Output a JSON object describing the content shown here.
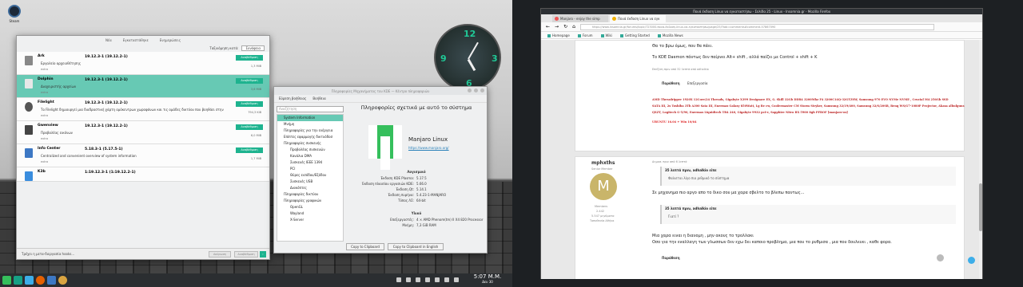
{
  "desktop": {
    "steam_label": "Steam",
    "clock_numbers": [
      "12",
      "3",
      "6",
      "9"
    ]
  },
  "discover": {
    "tabs": [
      "Νέα",
      "Εγκαταστάθηκε",
      "Ενημερώσεις"
    ],
    "sort_label": "Ταξινόμηση κατά:",
    "sort_value": "Συνάφεια",
    "items": [
      {
        "name": "Ark",
        "version": "19.12.3-1 (19.12.2-1)",
        "desc": "Εργαλείο αρχειοθέτησης",
        "source": "extra",
        "button": "Αναβάθμιση",
        "size": "1,3 MiB"
      },
      {
        "name": "Dolphin",
        "version": "19.12.3-1 (19.12.2-1)",
        "desc": "Διαχειριστής αρχείων",
        "source": "extra",
        "button": "Αναβάθμιση",
        "size": "3,6 MiB"
      },
      {
        "name": "Filelight",
        "version": "19.12.3-1 (19.12.2-1)",
        "desc": "Το Filelight δημιουργεί μια διαδραστική χάρτη ομόκεντρων χωροφάνων και τις ομάδες δικτύου που βοηθάει στην απ",
        "source": "extra",
        "button": "Αναβάθμιση",
        "size": "794,3 KiB"
      },
      {
        "name": "Gwenview",
        "version": "19.12.3-1 (19.12.2-1)",
        "desc": "Προβολέας εικόνων",
        "source": "extra",
        "button": "Αναβάθμιση",
        "size": "6,0 MiB"
      },
      {
        "name": "Info Center",
        "version": "5.18.3-1 (5.17.5-1)",
        "desc": "Centralized and convenient overview of system information",
        "source": "extra",
        "button": "Αναβάθμιση",
        "size": "1,7 MiB"
      },
      {
        "name": "K3b",
        "version": "1:19.12.3-1 (1:19.12.2-1)",
        "desc": "",
        "source": "",
        "button": "",
        "size": ""
      }
    ],
    "footer_status": "Τρέχει η μετα-διεργασία hooks...",
    "footer_btn1": "Ακύρωση",
    "footer_btn2": "Αναβάθμιση"
  },
  "info": {
    "title": "Πληροφορίες Μηχανήματος του KDE — Κέντρο πληροφοριών",
    "toolbar": [
      "Εύρεση βοήθειας",
      "Βοήθεια"
    ],
    "search_placeholder": "Αναζήτηση",
    "tree": [
      {
        "label": "System Information",
        "sel": true,
        "sub": false
      },
      {
        "label": "Μνήμη",
        "sel": false,
        "sub": false
      },
      {
        "label": "Πληροφορίες για την ενέργεια",
        "sel": false,
        "sub": false
      },
      {
        "label": "Επίπτες εφαρμογής δικτυόδοσ",
        "sel": false,
        "sub": false
      },
      {
        "label": "Πληροφορίες συσκευής",
        "sel": false,
        "sub": false
      },
      {
        "label": "Προβολέας συσκευών",
        "sel": false,
        "sub": true
      },
      {
        "label": "Κανάλια DMA",
        "sel": false,
        "sub": true
      },
      {
        "label": "Συσκευές IEEE 1394",
        "sel": false,
        "sub": true
      },
      {
        "label": "PCI",
        "sel": false,
        "sub": true
      },
      {
        "label": "Θύρες εισόδου/Εξόδου",
        "sel": false,
        "sub": true
      },
      {
        "label": "Συσκευές USB",
        "sel": false,
        "sub": true
      },
      {
        "label": "Διακόπτες",
        "sel": false,
        "sub": true
      },
      {
        "label": "Πληροφορίες δικτύου",
        "sel": false,
        "sub": false
      },
      {
        "label": "Πληροφορίες γραφικών",
        "sel": false,
        "sub": false
      },
      {
        "label": "OpenGL",
        "sel": false,
        "sub": true
      },
      {
        "label": "Wayland",
        "sel": false,
        "sub": true
      },
      {
        "label": "X-Server",
        "sel": false,
        "sub": true
      }
    ],
    "heading": "Πληροφορίες σχετικά με αυτό το σύστημα",
    "distro": "Manjaro Linux",
    "url": "https://www.manjaro.org/",
    "software_heading": "Λογισμικό",
    "software": [
      {
        "k": "Έκδοση KDE Plasma:",
        "v": "5.17.5"
      },
      {
        "k": "Έκδοση πλαισίου εργασιών KDE:",
        "v": "5.66.0"
      },
      {
        "k": "Έκδοση Qt:",
        "v": "5.14.1"
      },
      {
        "k": "Έκδοση πυρήνα:",
        "v": "5.4.23-1-MANJARO"
      },
      {
        "k": "Τύπος ΛΣ:",
        "v": "64-bit"
      }
    ],
    "hardware_heading": "Υλικό",
    "hardware": [
      {
        "k": "Επεξεργαστές:",
        "v": "4 × AMD Phenom(tm) II X4 820 Processor"
      },
      {
        "k": "Μνήμη:",
        "v": "7,3 GiB RAM"
      }
    ],
    "btn_copy": "Copy to Clipboard",
    "btn_copy_en": "Copy to Clipboard in English"
  },
  "taskbar": {
    "time": "5:07 Μ.Μ.",
    "date": "Δευ 30"
  },
  "firefox": {
    "title": "Πουά έκδοση Linux να εγκαταστήσω - Σελίδα 25 - Linux - Insomnia.gr - Mozilla Firefox",
    "tabs": [
      "Manjaro - enjoy the simp",
      "Πουά έκδοση Linux να εγκ"
    ],
    "url": "https://www.insomnia.gr/forums/topic/723000-πουα-έκδοση-linux-να-εγκαταστήσω/page/25/?tab=comments#comment-57867090",
    "bookmarks": [
      "Homepage",
      "Forum",
      "Wiki",
      "Getting Started",
      "Mozilla News"
    ],
    "post1_line1": "Θα το βρω όμως, που θα πάει.",
    "post1_line2": "Το KDE Daemon πάντως δεν παίρνει Alt+ shift , αλλά παίζει με Control + shift + K",
    "post1_edit": "Επεξ/ση πριν από 32 λεπτά από adhalkio",
    "reply_label": "Παράθεση",
    "react_label": "Επεξεργασία",
    "sig1": "AMD Threadripper 1920X 12Core/24 Threads, Gigabyte X399 Designare EX, G. Skill 32Gb DDR4 3200Mhz F4 3200C14Q-32GTZSW, Samsung 970 EVO NVMe NVME , Crucial M4 256Gb SSD",
    "sig2": "SATA III, 2x Toshiba 3Tb A300 Sata III, Enermax Galaxy 850Watt, Lg Re cw, Coolermaster CM Storm Stryker, Samsung 32/19/400, Samsung 32/S/20SB, Benq WS/G7-1080P Projector, Akasa alhulguns",
    "sig3": "QXZT, Logitech G-5/90, Enermax Liquidtech TR4 240, Gigabyte 9932 pci-e, Sapphire Nitro RX 5900 8gb PFROF [manjaro-os]",
    "sig4": "UBUNTU 16.04 + Win 10/64",
    "user": "mphxths",
    "user_role": "Senior Member",
    "user_initial": "M",
    "user_group": "Members",
    "user_posts": "2.442",
    "user_rep": "5.547 μηνύματα",
    "user_loc": "Τοποθεσία Αθήνα",
    "post2_time": "Δημοσ. πριν από 6 λεπτά",
    "quote1_head": "35 λεπτά πριν, adhalkio είπε",
    "quote1_body": "Φαίνεται λίγο πιο ριθμικό το σύστημα",
    "post2_text": "Σε μηχανημα πιο αργο απο το δικο σου μα χαρα σβελτο το βλεπω παντως...",
    "quote2_head": "35 λεπτά πριν, adhalkio είπε",
    "quote2_body": "Γιατί ?",
    "post2_text2": "Μια χαρα ειναι η διανομη , μην ακους το τρολλακι",
    "post2_text3": "Οσο για την εναλλαγη των γλωσσων δεν εχω δει καποιο προβλημα, μια που το ρυθμισα , μια που δουλευει , καθε φορα."
  }
}
